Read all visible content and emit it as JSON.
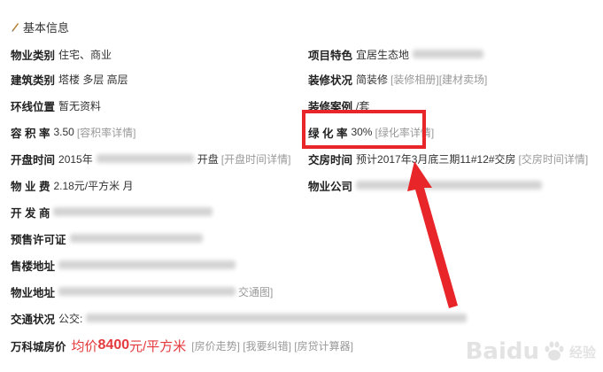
{
  "section": {
    "title": "基本信息",
    "icon": "pencil-icon"
  },
  "left": {
    "property_type": {
      "label": "物业类别",
      "value": "住宅、商业"
    },
    "building_type": {
      "label": "建筑类别",
      "value": "塔楼 多层 高层"
    },
    "ring_location": {
      "label": "环线位置",
      "value": "暂无资料"
    },
    "plot_ratio": {
      "label": "容 积 率",
      "value": "3.50",
      "link": "[容积率详情]"
    },
    "opening_time": {
      "label": "开盘时间",
      "value_prefix": "2015年",
      "value_suffix": "开盘",
      "link": "[开盘时间详情]"
    },
    "property_fee": {
      "label": "物 业 费",
      "value": "2.18元/平方米 月"
    },
    "developer": {
      "label": "开 发 商"
    },
    "presale_permit": {
      "label": "预售许可证"
    },
    "sales_address": {
      "label": "售楼地址"
    },
    "property_address": {
      "label": "物业地址",
      "link": "交通图]"
    },
    "traffic": {
      "label": "交通状况",
      "value": "公交:"
    },
    "price": {
      "label": "万科城房价",
      "prefix": "均价",
      "number": "8400",
      "unit": "元/平方米",
      "links": "[房价走势] [我要纠错] [房贷计算器]"
    }
  },
  "right": {
    "features": {
      "label": "项目特色",
      "value": "宜居生态地"
    },
    "decoration": {
      "label": "装修状况",
      "value": "简装修",
      "link": "[装修相册][建材卖场]"
    },
    "decoration_case": {
      "label": "装修案例",
      "value": "/套"
    },
    "green_ratio": {
      "label": "绿 化 率",
      "value": "30%",
      "link": "[绿化率详情]"
    },
    "delivery_time": {
      "label": "交房时间",
      "value": "预计2017年3月底三期11#12#交房",
      "link": "[交房时间详情]"
    },
    "property_company": {
      "label": "物业公司"
    }
  },
  "annotation": {
    "color": "#e8262a"
  },
  "watermark": {
    "brand": "Baidu",
    "text": "经验",
    "icon": "baidu-paw-icon"
  },
  "colors": {
    "price": "#e4393c",
    "link": "#999999",
    "highlight": "#e8262a"
  }
}
